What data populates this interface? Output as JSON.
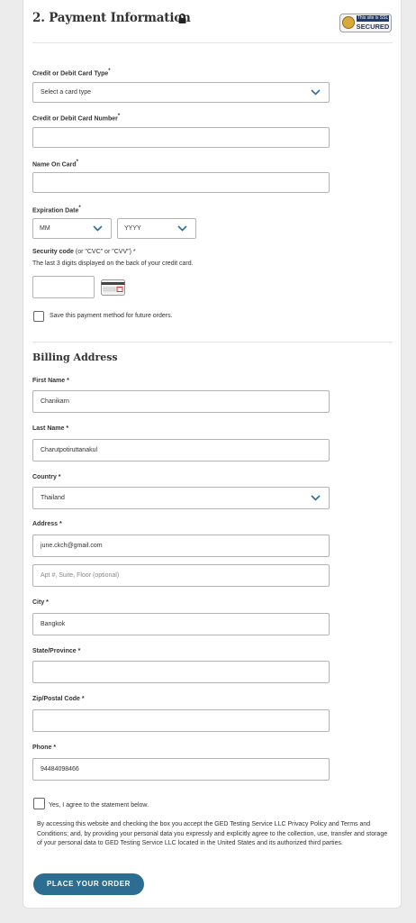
{
  "payment": {
    "title": "2. Payment Information",
    "ssl_badge_top": "This site is SSL",
    "ssl_badge_bottom": "SECURED",
    "card_type_label": "Credit or Debit Card Type",
    "card_type_value": "Select a card type",
    "card_number_label": "Credit or Debit Card Number",
    "card_number_value": "",
    "name_on_card_label": "Name On Card",
    "name_on_card_value": "",
    "expiration_label": "Expiration Date",
    "exp_month": "MM",
    "exp_year": "YYYY",
    "security_code_label": "Security code",
    "security_code_hint": " (or \"CVC\" or \"CVV\") *",
    "security_code_help": "The last 3 digits displayed on the back of your credit card.",
    "save_method_label": "Save this payment method for future orders.",
    "required_mark": "*"
  },
  "billing": {
    "title": "Billing Address",
    "first_name_label": "First Name *",
    "first_name_value": "Chanikarn",
    "last_name_label": "Last Name *",
    "last_name_value": "Charutpotiruttanakul",
    "country_label": "Country *",
    "country_value": "Thailand",
    "address_label": "Address *",
    "address_value": "june.ckch@gmail.com",
    "address2_placeholder": "Apt #, Suite, Floor (optional)",
    "city_label": "City *",
    "city_value": "Bangkok",
    "state_label": "State/Province *",
    "state_value": "",
    "zip_label": "Zip/Postal Code *",
    "zip_value": "",
    "phone_label": "Phone *",
    "phone_value": "94484098466"
  },
  "agreement": {
    "checkbox_label": "Yes, I agree to the statement below.",
    "legal_text": "By accessing this website and checking the box you accept the GED Testing Service LLC Privacy Policy and Terms and Conditions; and, by providing your personal data you expressly and explicitly agree to the collection, use, transfer and storage of your personal data to GED Testing Service LLC located in the United States and its authorized third parties."
  },
  "submit_label": "PLACE YOUR ORDER",
  "colors": {
    "accent": "#2d6d91",
    "chevron": "#2e6da4",
    "background": "#ececec"
  }
}
